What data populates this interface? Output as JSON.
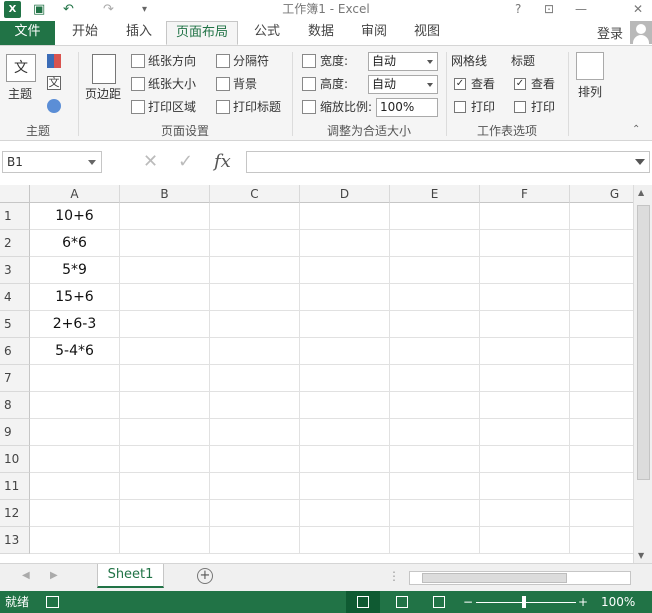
{
  "window": {
    "title": "工作簿1 - Excel",
    "app_icon": "X",
    "help": "?",
    "minimize": "—",
    "close": "✕"
  },
  "ribbon_tabs": [
    "文件",
    "开始",
    "插入",
    "页面布局",
    "公式",
    "数据",
    "审阅",
    "视图"
  ],
  "active_tab": "页面布局",
  "login": "登录",
  "ribbon": {
    "theme": {
      "label": "主题",
      "group": "主题",
      "icon": "文"
    },
    "page_setup": {
      "margins": "页边距",
      "orientation": "纸张方向",
      "size": "纸张大小",
      "print_area": "打印区域",
      "breaks": "分隔符",
      "background": "背景",
      "print_titles": "打印标题",
      "group": "页面设置"
    },
    "scale": {
      "width_label": "宽度:",
      "width_value": "自动",
      "height_label": "高度:",
      "height_value": "自动",
      "scale_label": "缩放比例:",
      "scale_value": "100%",
      "group": "调整为合适大小"
    },
    "sheet_options": {
      "gridlines": "网格线",
      "headings": "标题",
      "view": "查看",
      "print": "打印",
      "group": "工作表选项"
    },
    "arrange": {
      "label": "排列"
    }
  },
  "formula_bar": {
    "name_box": "B1",
    "cancel": "✕",
    "enter": "✓",
    "fx": "fx",
    "value": ""
  },
  "grid": {
    "columns": [
      "A",
      "B",
      "C",
      "D",
      "E",
      "F",
      "G"
    ],
    "rows": [
      "1",
      "2",
      "3",
      "4",
      "5",
      "6",
      "7",
      "8",
      "9",
      "10",
      "11",
      "12",
      "13"
    ],
    "cells_A": [
      "10+6",
      "6*6",
      "5*9",
      "15+6",
      "2+6-3",
      "5-4*6"
    ]
  },
  "sheet_tabs": [
    "Sheet1"
  ],
  "status": {
    "ready": "就绪",
    "zoom": "100%"
  }
}
